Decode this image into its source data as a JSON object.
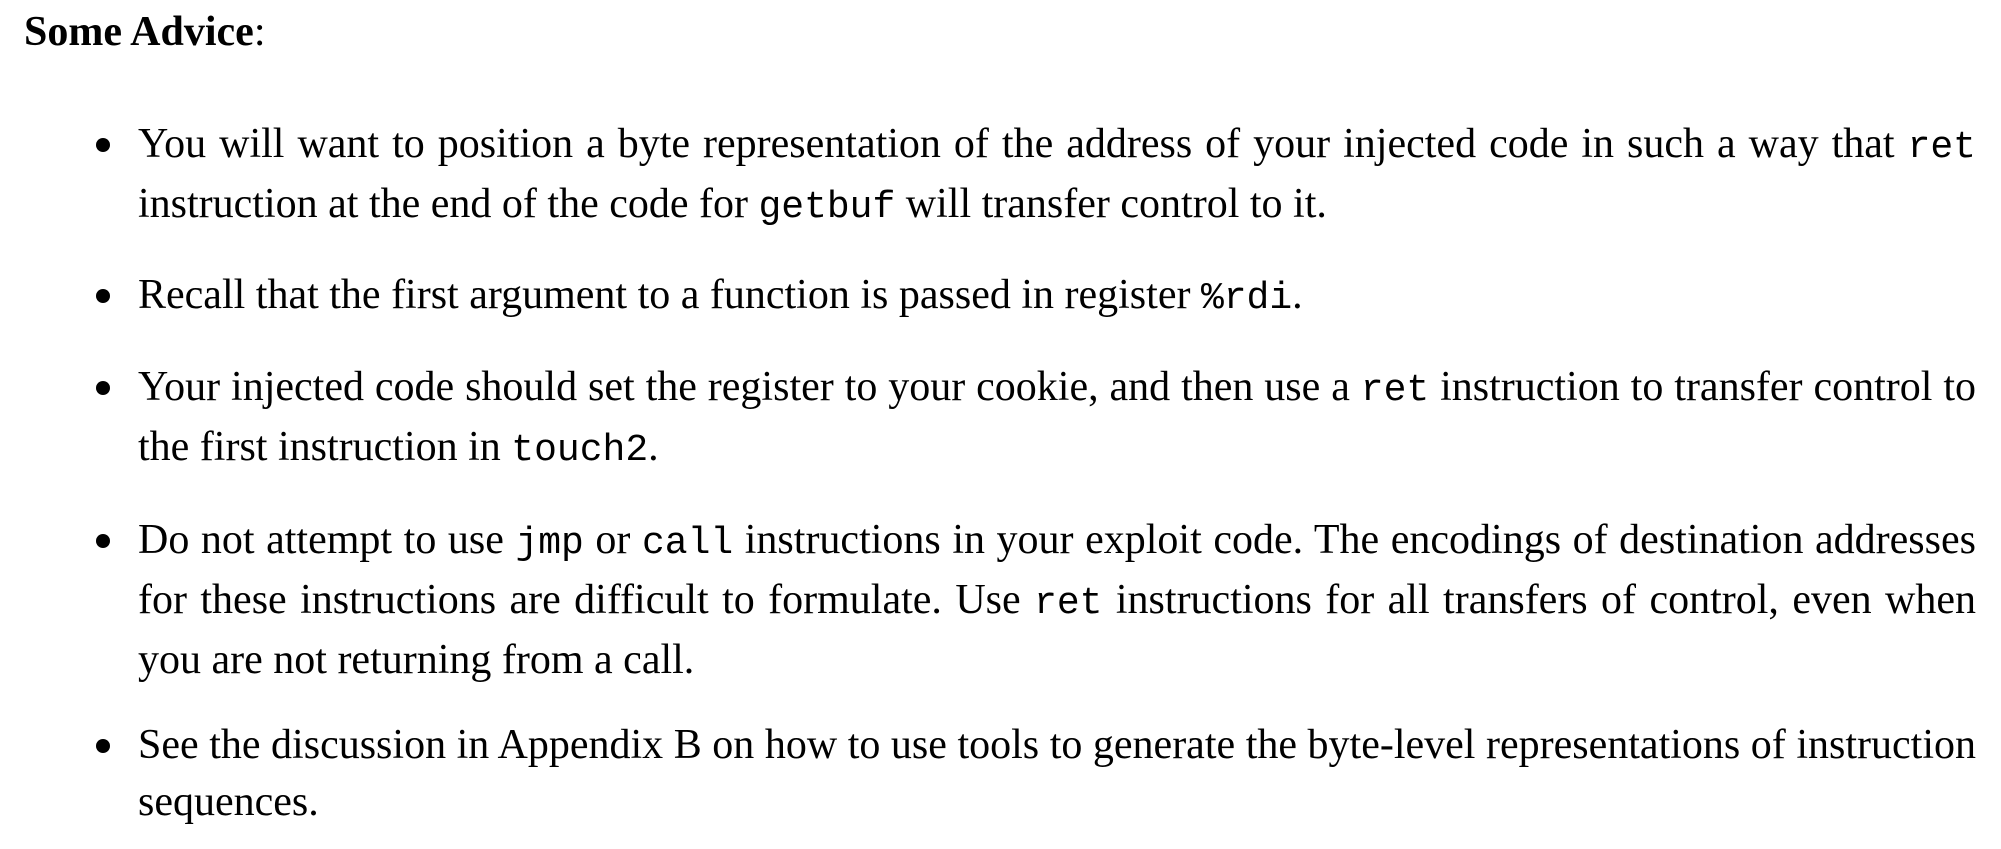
{
  "heading": {
    "title": "Some Advice",
    "colon": ":"
  },
  "items": [
    {
      "parts": [
        {
          "t": "text",
          "v": "You will want to position a byte representation of the address of your injected code in such a way that "
        },
        {
          "t": "code",
          "v": "ret"
        },
        {
          "t": "text",
          "v": " instruction at the end of the code for "
        },
        {
          "t": "code",
          "v": "getbuf"
        },
        {
          "t": "text",
          "v": " will transfer control to it."
        }
      ]
    },
    {
      "parts": [
        {
          "t": "text",
          "v": "Recall that the first argument to a function is passed in register "
        },
        {
          "t": "code",
          "v": "%rdi"
        },
        {
          "t": "text",
          "v": "."
        }
      ]
    },
    {
      "parts": [
        {
          "t": "text",
          "v": "Your injected code should set the register to your cookie, and then use a "
        },
        {
          "t": "code",
          "v": "ret"
        },
        {
          "t": "text",
          "v": " instruction to transfer control to the first instruction in "
        },
        {
          "t": "code",
          "v": "touch2"
        },
        {
          "t": "text",
          "v": "."
        }
      ]
    },
    {
      "parts": [
        {
          "t": "text",
          "v": "Do not attempt to use "
        },
        {
          "t": "code",
          "v": "jmp"
        },
        {
          "t": "text",
          "v": " or "
        },
        {
          "t": "code",
          "v": "call"
        },
        {
          "t": "text",
          "v": " instructions in your exploit code. The encodings of destination addresses for these instructions are difficult to formulate. Use "
        },
        {
          "t": "code",
          "v": "ret"
        },
        {
          "t": "text",
          "v": " instructions for all transfers of control, even when you are not returning from a call."
        }
      ]
    },
    {
      "parts": [
        {
          "t": "text",
          "v": "See the discussion in Appendix B on how to use tools to generate the byte-level representations of instruction sequences."
        }
      ]
    }
  ]
}
